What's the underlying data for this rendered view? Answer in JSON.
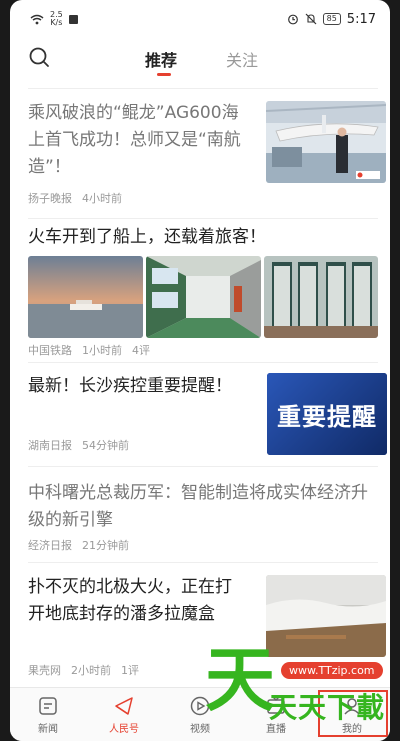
{
  "status_bar": {
    "speed_value": "2.5",
    "speed_unit": "K/s",
    "battery": "85",
    "time": "5:17"
  },
  "top_tabs": [
    {
      "label": "推荐",
      "active": true
    },
    {
      "label": "关注",
      "active": false
    }
  ],
  "feed": [
    {
      "title": "乘风破浪的“鲲龙”AG600海上首飞成功！总师又是“南航造”！",
      "source": "扬子晚报",
      "time": "4小时前",
      "read": true
    },
    {
      "title": "火车开到了船上，还载着旅客！",
      "source": "中国铁路",
      "time": "1小时前",
      "comments": "4评",
      "read": false
    },
    {
      "title": "最新！长沙疾控重要提醒！",
      "source": "湖南日报",
      "time": "54分钟前",
      "thumb_text": "重要提醒",
      "read": false
    },
    {
      "title": "中科曙光总裁历军：智能制造将成实体经济升级的新引擎",
      "source": "经济日报",
      "time": "21分钟前",
      "read": true
    },
    {
      "title": "扑不灭的北极大火，正在打开地底封存的潘多拉魔盒",
      "source": "果壳网",
      "time": "2小时前",
      "comments": "1评",
      "read": false
    }
  ],
  "bottom_tabs": [
    {
      "label": "新闻",
      "icon": "news-icon"
    },
    {
      "label": "人民号",
      "icon": "paper-plane-icon",
      "active": true
    },
    {
      "label": "视频",
      "icon": "play-icon"
    },
    {
      "label": "直播",
      "icon": "live-icon"
    },
    {
      "label": "我的",
      "icon": "person-icon"
    }
  ],
  "watermark": {
    "url": "www.TTzip.com",
    "text": "天天下載"
  },
  "colors": {
    "accent": "#e5402f",
    "text": "#222222",
    "read_text": "#777777",
    "meta": "#9a9a9a"
  }
}
